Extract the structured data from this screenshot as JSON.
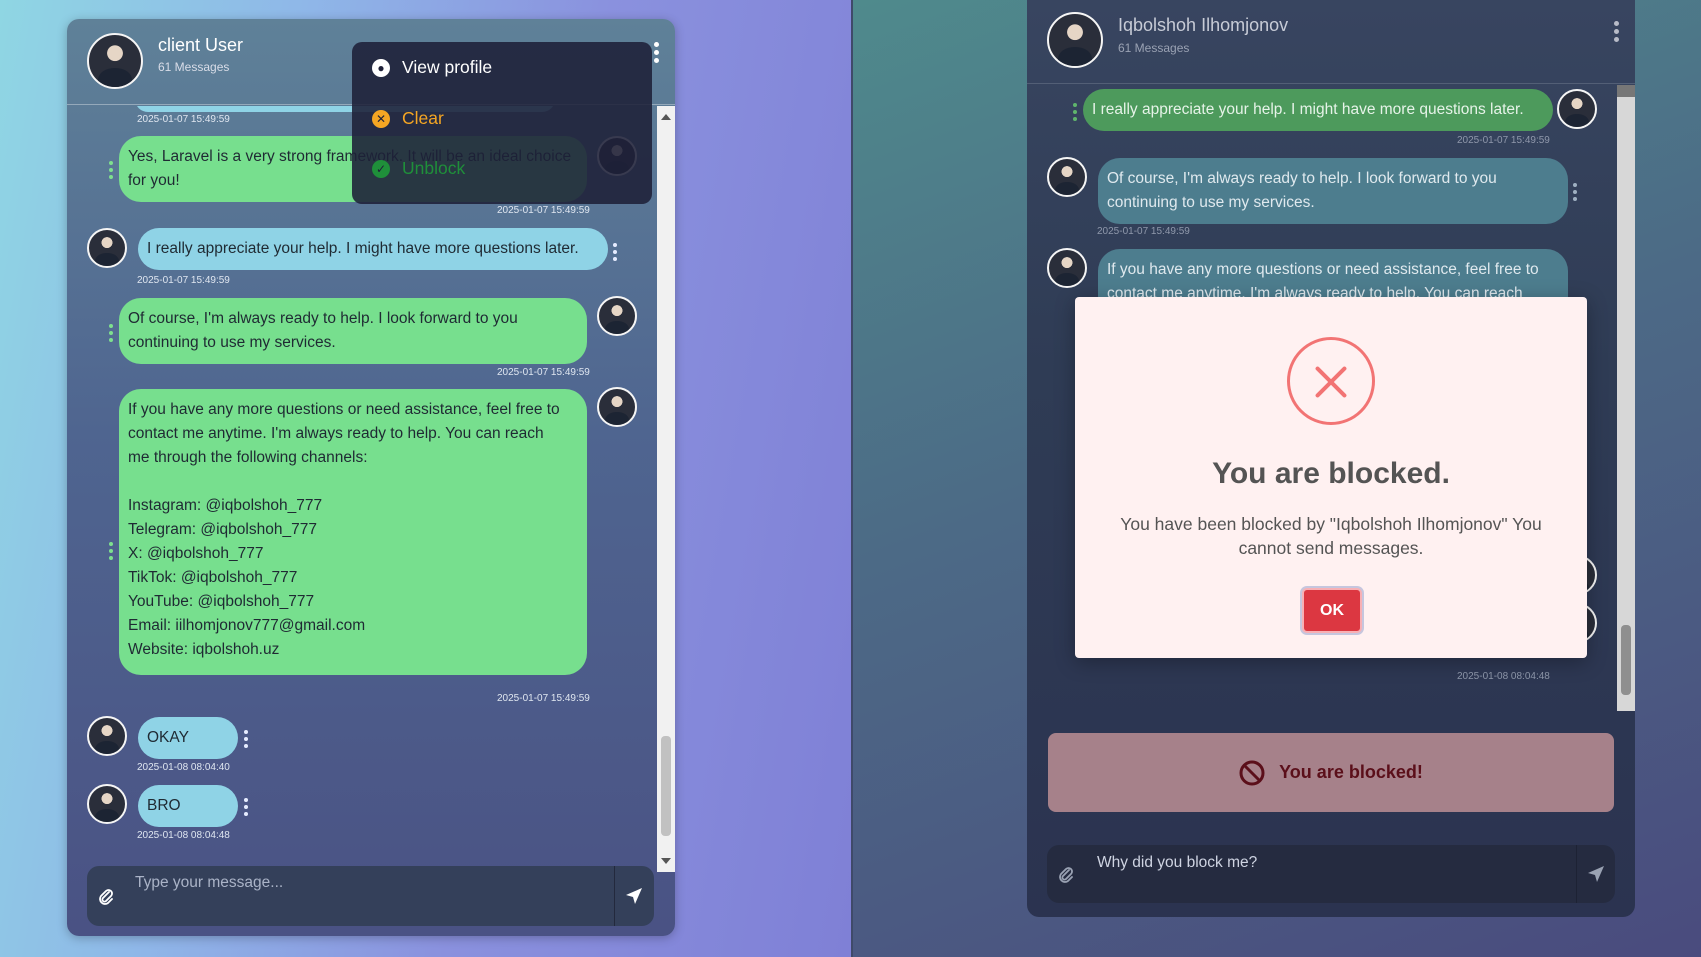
{
  "left_chat": {
    "header": {
      "name": "client User",
      "count": "61 Messages"
    },
    "dropdown": [
      {
        "label": "View profile",
        "color": "#ffffff"
      },
      {
        "label": "Clear",
        "color": "#f5a623"
      },
      {
        "label": "Unblock",
        "color": "#1f8f3a"
      }
    ],
    "messages": [
      {
        "text": "Yes, Laravel is a very strong framework. It will be an ideal choice for you!",
        "time": "2025-01-07 15:49:59"
      },
      {
        "text": "I really appreciate your help. I might have more questions later.",
        "time": "2025-01-07 15:49:59"
      },
      {
        "text": "Of course, I'm always ready to help. I look forward to you continuing to use my services.",
        "time": "2025-01-07 15:49:59"
      },
      {
        "lines": [
          "If you have any more questions or need assistance, feel free to",
          "contact me anytime. I'm always ready to help. You can reach",
          "me through the following channels:",
          "",
          "Instagram: @iqbolshoh_777",
          "Telegram: @iqbolshoh_777",
          "X: @iqbolshoh_777",
          "TikTok: @iqbolshoh_777",
          "YouTube: @iqbolshoh_777",
          "Email: iilhomjonov777@gmail.com",
          "Website: iqbolshoh.uz"
        ],
        "time": "2025-01-07 15:49:59"
      },
      {
        "text": "OKAY",
        "time": "2025-01-08 08:04:40"
      },
      {
        "text": "BRO",
        "time": "2025-01-08 08:04:48"
      }
    ],
    "prev_time": "2025-01-07 15:49:59",
    "input_placeholder": "Type your message..."
  },
  "right_chat": {
    "header": {
      "name": "Iqbolshoh Ilhomjonov",
      "count": "61 Messages"
    },
    "messages": [
      {
        "text": "I really appreciate your help. I might have more questions later.",
        "time": "2025-01-07 15:49:59"
      },
      {
        "text": "Of course, I'm always ready to help. I look forward to you continuing to use my services.",
        "time": "2025-01-07 15:49:59"
      },
      {
        "text": "If you have any more questions or need assistance, feel free to contact me anytime. I'm always ready to help. You can reach"
      }
    ],
    "last_time": "2025-01-08 08:04:48",
    "blocked_banner": "You are blocked!",
    "input_value": "Why did you block me?"
  },
  "modal": {
    "title": "You are blocked.",
    "text": "You have been blocked by \"Iqbolshoh Ilhomjonov\" You cannot send messages.",
    "ok": "OK"
  },
  "colors": {
    "accent_green": "#77df8e",
    "accent_blue": "#8fd3e6",
    "danger": "#dc3741"
  }
}
